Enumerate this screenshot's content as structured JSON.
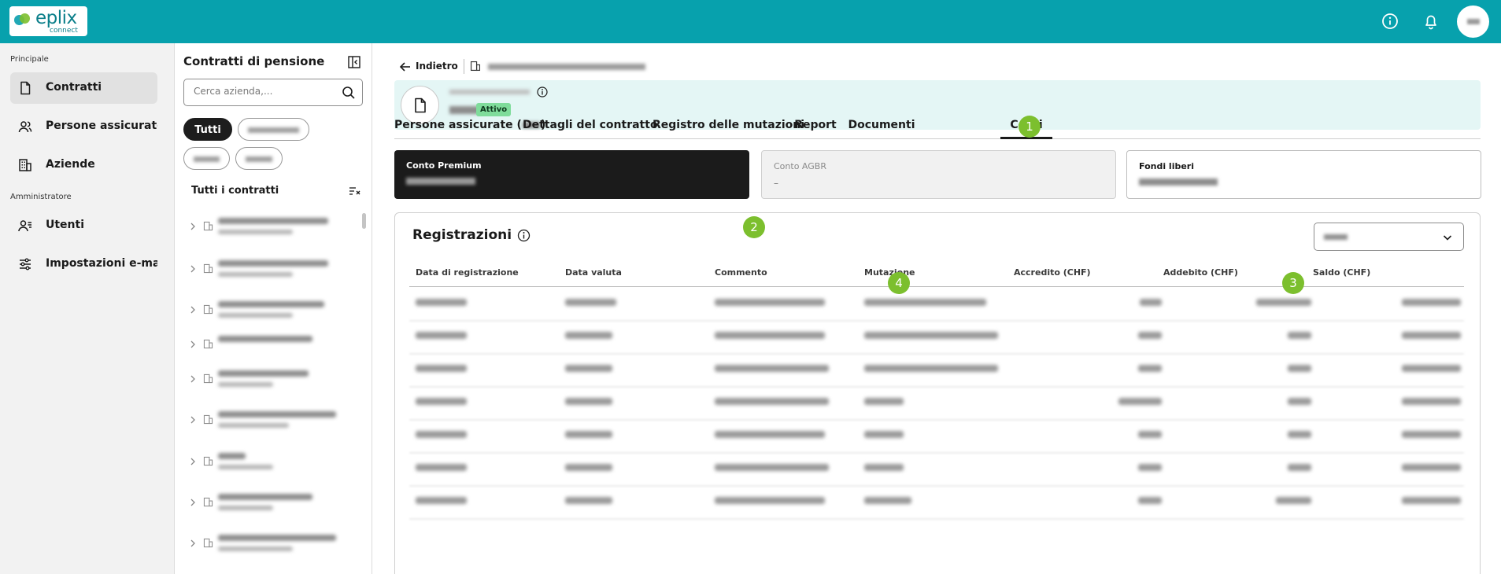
{
  "brand": {
    "name": "eplix",
    "sub": "connect"
  },
  "sidebar": {
    "sections": [
      {
        "label": "Principale"
      },
      {
        "label": "Amministratore"
      }
    ],
    "items": [
      {
        "label": "Contratti",
        "icon": "document-icon",
        "active": true
      },
      {
        "label": "Persone assicurate",
        "icon": "people-icon"
      },
      {
        "label": "Aziende",
        "icon": "building-icon"
      },
      {
        "label": "Utenti",
        "icon": "users-icon"
      },
      {
        "label": "Impostazioni e-mail",
        "icon": "sliders-icon"
      }
    ]
  },
  "contracts_panel": {
    "title": "Contratti di pensione",
    "search_placeholder": "Cerca azienda,...",
    "chips": [
      {
        "label": "Tutti",
        "selected": true
      }
    ],
    "list_header": "Tutti i contratti"
  },
  "main": {
    "back_label": "Indietro",
    "status_badge": "Attivo",
    "tabs": [
      {
        "label": "Persone assicurate (",
        "suffix": ")"
      },
      {
        "label": "Dettagli del contratto"
      },
      {
        "label": "Registro delle mutazioni"
      },
      {
        "label": "Report"
      },
      {
        "label": "Documenti"
      },
      {
        "label": "Conti",
        "active": true
      }
    ],
    "markers": [
      "1",
      "2",
      "3",
      "4"
    ],
    "accounts": [
      {
        "title": "Conto Premium",
        "style": "dark"
      },
      {
        "title": "Conto AGBR",
        "value": "–",
        "style": "disabled"
      },
      {
        "title": "Fondi liberi",
        "style": "outline"
      }
    ],
    "registrations": {
      "title": "Registrazioni",
      "columns": [
        "Data di registrazione",
        "Data valuta",
        "Commento",
        "Mutazione",
        "Accredito (CHF)",
        "Addebito (CHF)",
        "Saldo (CHF)"
      ]
    }
  },
  "colors": {
    "topbar": "#07a1ad",
    "accent_green": "#7cbf2e",
    "header_card": "#e4f6f5",
    "badge": "#7fdc9b"
  }
}
